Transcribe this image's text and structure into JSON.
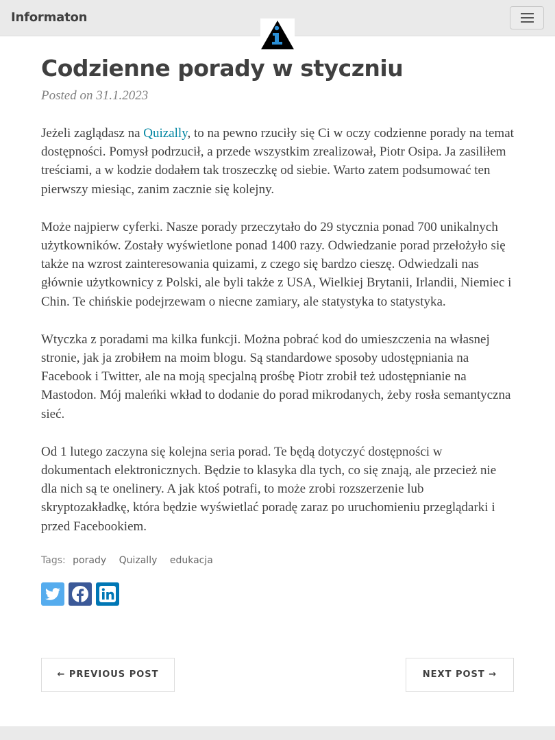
{
  "navbar": {
    "brand": "Informaton",
    "menu_icon": "hamburger-menu-icon",
    "logo_icon": "info-triangle-logo-icon"
  },
  "post": {
    "title": "Codzienne porady w styczniu",
    "meta": "Posted on 31.1.2023",
    "p1_before": "Jeżeli zaglądasz na ",
    "p1_link": "Quizally",
    "p1_after": ", to na pewno rzuciły się Ci w oczy codzienne porady na temat dostępności. Pomysł podrzucił, a przede wszystkim zrealizował, Piotr Osipa. Ja zasiliłem treściami, a w kodzie dodałem tak troszeczkę od siebie. Warto zatem podsumować ten pierwszy miesiąc, zanim zacznie się kolejny.",
    "p2": "Może najpierw cyferki. Nasze porady przeczytało do 29 stycznia ponad 700 unikalnych użytkowników. Zostały wyświetlone ponad 1400 razy. Odwiedzanie porad przełożyło się także na wzrost zainteresowania quizami, z czego się bardzo cieszę. Odwiedzali nas głównie użytkownicy z Polski, ale byli także z USA, Wielkiej Brytanii, Irlandii, Niemiec i Chin. Te chińskie podejrzewam o niecne zamiary, ale statystyka to statystyka.",
    "p3": "Wtyczka z poradami ma kilka funkcji. Można pobrać kod do umieszczenia na własnej stronie, jak ja zrobiłem na moim blogu. Są standardowe sposoby udostępniania na Facebook i Twitter, ale na moją specjalną prośbę Piotr zrobił też udostępnianie na Mastodon. Mój maleńki wkład to dodanie do porad mikrodanych, żeby rosła semantyczna sieć.",
    "p4": "Od 1 lutego zaczyna się kolejna seria porad. Te będą dotyczyć dostępności w dokumentach elektronicznych. Będzie to klasyka dla tych, co się znają, ale przecież nie dla nich są te onelinery. A jak ktoś potrafi, to może zrobi rozszerzenie lub skryptozakładkę, która będzie wyświetlać poradę zaraz po uruchomieniu przeglądarki i przed Facebookiem."
  },
  "tags": {
    "label": "Tags:",
    "items": [
      "porady",
      "Quizally",
      "edukacja"
    ]
  },
  "share": {
    "icons": [
      "twitter-icon",
      "facebook-icon",
      "linkedin-icon"
    ],
    "colors": {
      "twitter": "#55acee",
      "facebook": "#3b5998",
      "linkedin": "#0077b5"
    }
  },
  "pager": {
    "previous": "← PREVIOUS POST",
    "next": "NEXT POST →"
  }
}
